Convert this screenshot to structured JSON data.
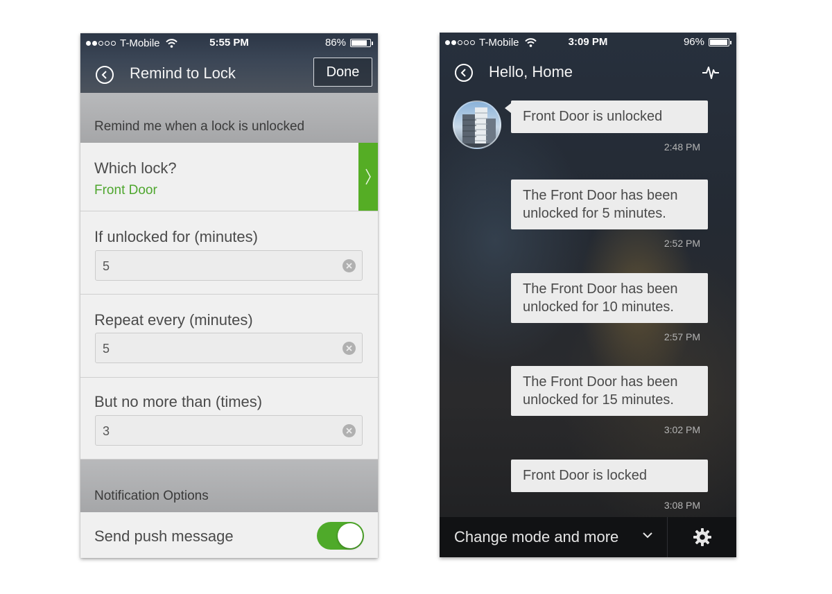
{
  "left_screen": {
    "status": {
      "carrier": "T-Mobile",
      "time": "5:55 PM",
      "battery": "86%",
      "battery_level": 0.86
    },
    "header": {
      "title": "Remind to Lock",
      "done_label": "Done"
    },
    "section_trigger": "Remind me when a lock is unlocked",
    "which_lock": {
      "label": "Which lock?",
      "value": "Front Door"
    },
    "unlocked_for": {
      "label": "If unlocked for (minutes)",
      "value": "5"
    },
    "repeat_every": {
      "label": "Repeat every (minutes)",
      "value": "5"
    },
    "max_times": {
      "label": "But no more than (times)",
      "value": "3"
    },
    "section_notification": "Notification Options",
    "push": {
      "label": "Send push message",
      "enabled": true
    }
  },
  "right_screen": {
    "status": {
      "carrier": "T-Mobile",
      "time": "3:09 PM",
      "battery": "96%",
      "battery_level": 0.96
    },
    "header": {
      "title": "Hello, Home"
    },
    "messages": [
      {
        "lines": [
          "Front Door is unlocked"
        ],
        "time": "2:48 PM"
      },
      {
        "lines": [
          "The Front Door has been",
          "unlocked for 5 minutes."
        ],
        "time": "2:52 PM"
      },
      {
        "lines": [
          "The Front Door has been",
          "unlocked for 10 minutes."
        ],
        "time": "2:57 PM"
      },
      {
        "lines": [
          "The Front Door has been",
          "unlocked for 15 minutes."
        ],
        "time": "3:02 PM"
      },
      {
        "lines": [
          "Front Door is locked"
        ],
        "time": "3:08 PM"
      }
    ],
    "bottom": {
      "mode_label": "Change mode and more"
    }
  },
  "colors": {
    "accent_green": "#55ad25",
    "link_green": "#4ea62e"
  }
}
